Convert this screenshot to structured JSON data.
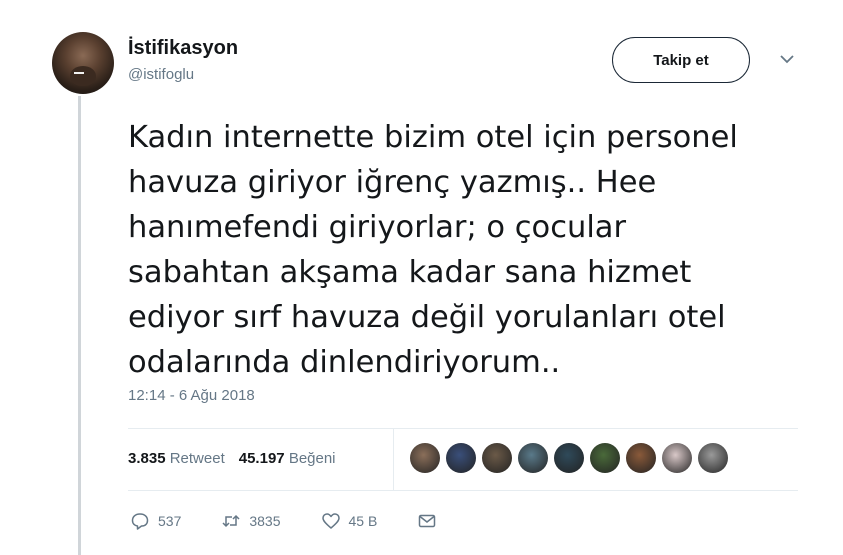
{
  "user": {
    "display_name": "İstifikasyon",
    "handle": "@istifoglu"
  },
  "follow_label": "Takip et",
  "tweet": {
    "lines": [
      "Kadın internette bizim otel için personel",
      "havuza giriyor iğrenç yazmış.. Hee",
      "hanımefendi giriyorlar; o çocular",
      "sabahtan akşama kadar sana hizmet",
      "ediyor sırf havuza değil yorulanları otel",
      "odalarında dinlendiriyorum.."
    ],
    "timestamp": "12:14 - 6 Ağu 2018"
  },
  "stats": {
    "retweet_count": "3.835",
    "retweet_label": "Retweet",
    "like_count": "45.197",
    "like_label": "Beğeni"
  },
  "liker_avatars": [
    "#8b6f5a",
    "#3a4f7a",
    "#6b5a48",
    "#5a7a8a",
    "#2f4a5a",
    "#4a6a3a",
    "#8a5a3a",
    "#d9c8c8",
    "#9a9a9a"
  ],
  "actions": {
    "reply_count": "537",
    "retweet_count": "3835",
    "like_count": "45 B"
  },
  "colors": {
    "text": "#14171a",
    "secondary": "#657786",
    "border": "#e6ecf0"
  },
  "icons": [
    "chevron-down-icon",
    "reply-icon",
    "retweet-icon",
    "like-icon",
    "message-icon"
  ]
}
